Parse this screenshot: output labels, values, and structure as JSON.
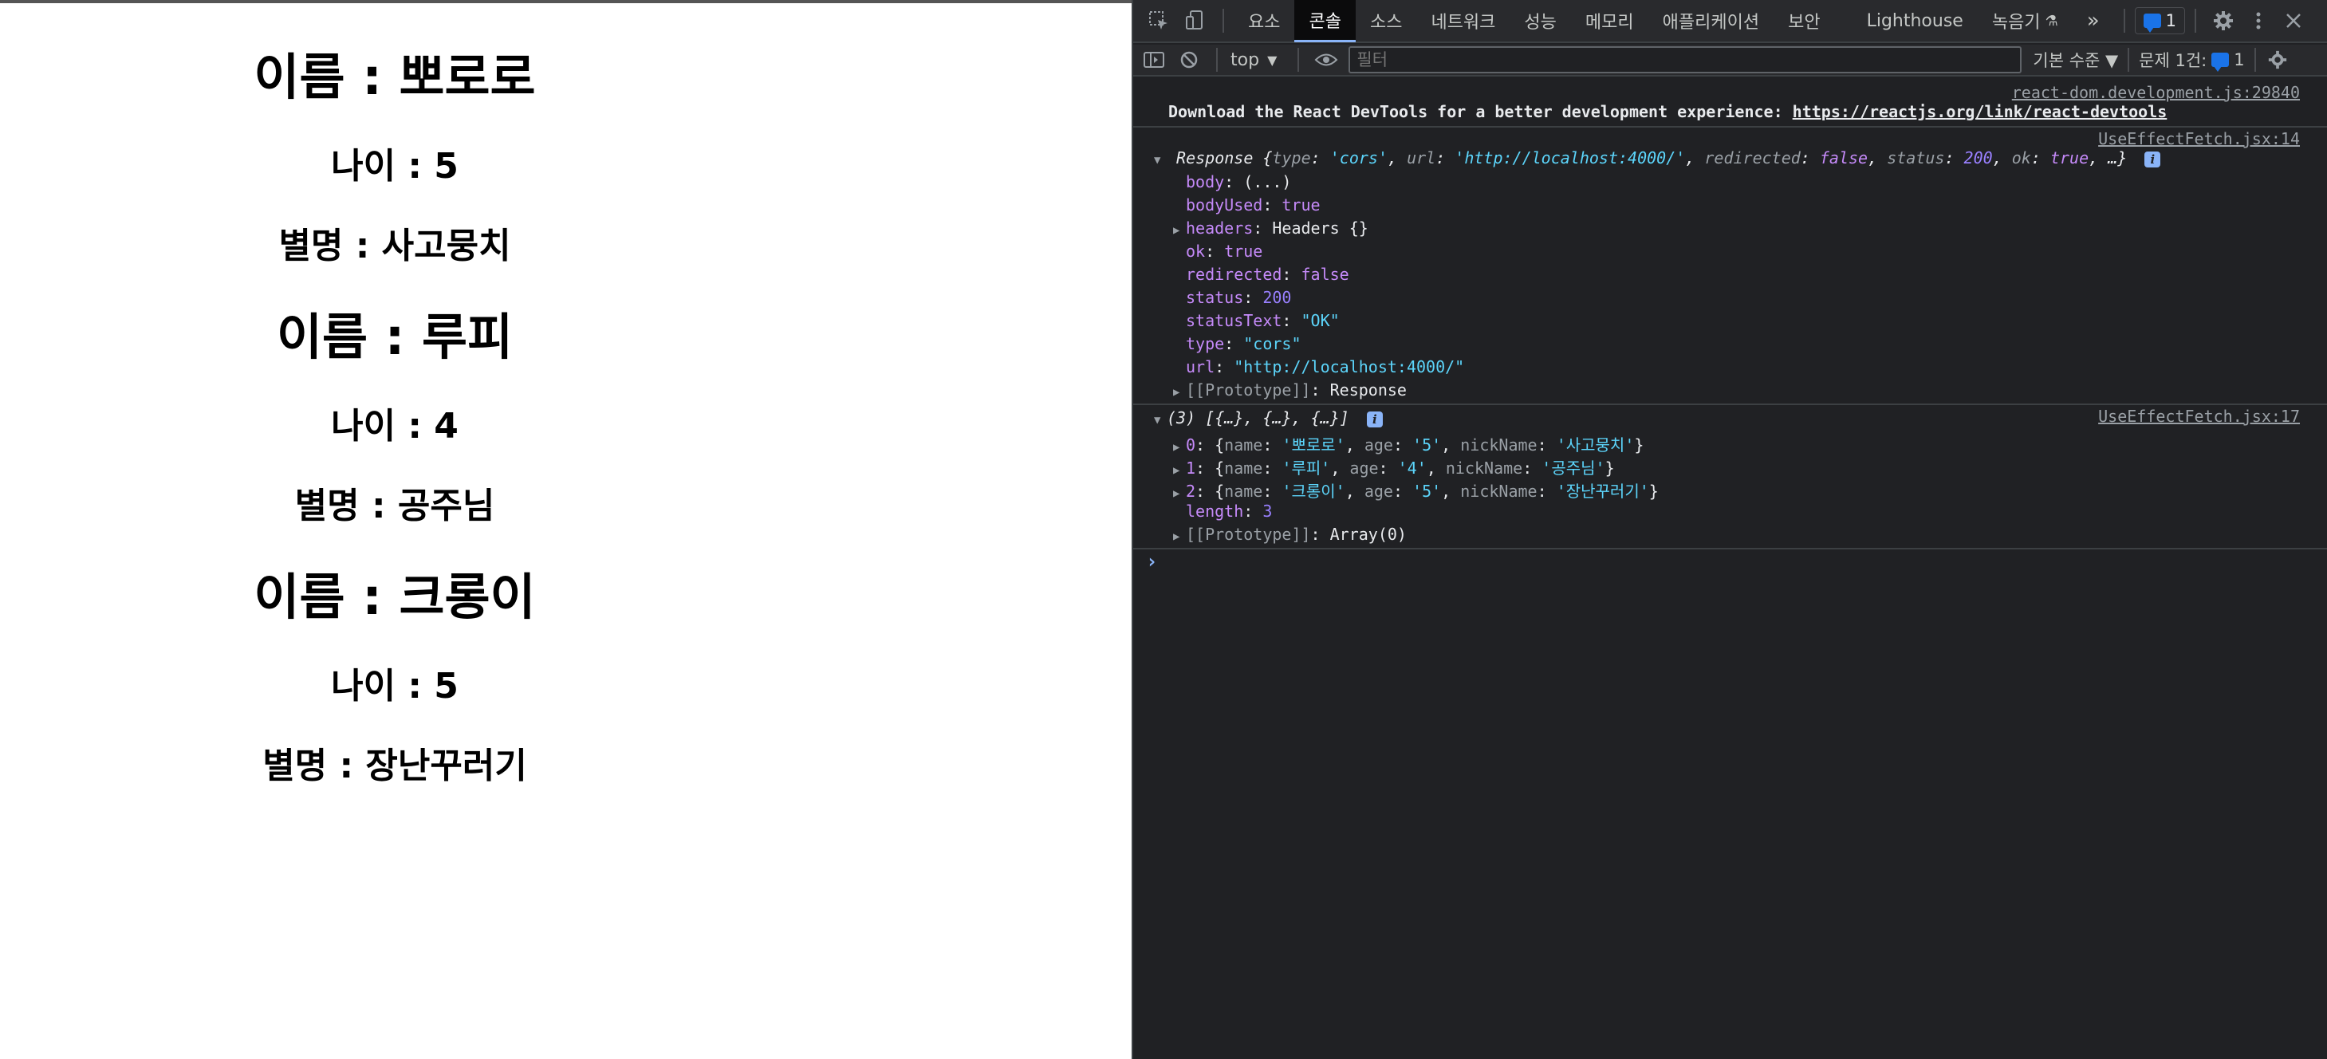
{
  "app": {
    "persons": [
      {
        "name_line": "이름 : 뽀로로",
        "age_line": "나이 : 5",
        "nick_line": "별명 : 사고뭉치"
      },
      {
        "name_line": "이름 : 루피",
        "age_line": "나이 : 4",
        "nick_line": "별명 : 공주님"
      },
      {
        "name_line": "이름 : 크롱이",
        "age_line": "나이 : 5",
        "nick_line": "별명 : 장난꾸러기"
      }
    ]
  },
  "devtools": {
    "tabs": [
      "요소",
      "콘솔",
      "소스",
      "네트워크",
      "성능",
      "메모리",
      "애플리케이션",
      "보안",
      "Lighthouse",
      "녹음기"
    ],
    "active_tab": "콘솔",
    "more_tabs_glyph": "»",
    "message_count": "1",
    "context": "top",
    "filter_placeholder": "필터",
    "level_label": "기본 수준 ▼",
    "issues_label": "문제 1건:",
    "issues_count": "1",
    "console": {
      "devtools_source": "react-dom.development.js:29840",
      "devtools_msg": "Download the React DevTools for a better development experience: ",
      "devtools_link": "https://reactjs.org/link/react-devtools",
      "response_source": "UseEffectFetch.jsx:14",
      "response_summary": {
        "label": "Response",
        "type": "'cors'",
        "url": "'http://localhost:4000/'",
        "redirected": "false",
        "status": "200",
        "ok": "true"
      },
      "response_props": [
        {
          "key": "body",
          "value": "(...)",
          "kind": "plain"
        },
        {
          "key": "bodyUsed",
          "value": "true",
          "kind": "bool"
        },
        {
          "key": "headers",
          "value": "Headers {}",
          "kind": "plain",
          "expandable": true
        },
        {
          "key": "ok",
          "value": "true",
          "kind": "bool"
        },
        {
          "key": "redirected",
          "value": "false",
          "kind": "bool"
        },
        {
          "key": "status",
          "value": "200",
          "kind": "num"
        },
        {
          "key": "statusText",
          "value": "\"OK\"",
          "kind": "str"
        },
        {
          "key": "type",
          "value": "\"cors\"",
          "kind": "str"
        },
        {
          "key": "url",
          "value": "\"http://localhost:4000/\"",
          "kind": "str"
        },
        {
          "key": "[[Prototype]]",
          "value": "Response",
          "kind": "plain",
          "expandable": true
        }
      ],
      "array_source": "UseEffectFetch.jsx:17",
      "array_summary": "(3) [{…}, {…}, {…}]",
      "array_items": [
        {
          "index": "0",
          "name": "'뽀로로'",
          "age": "'5'",
          "nickName": "'사고뭉치'"
        },
        {
          "index": "1",
          "name": "'루피'",
          "age": "'4'",
          "nickName": "'공주님'"
        },
        {
          "index": "2",
          "name": "'크롱이'",
          "age": "'5'",
          "nickName": "'장난꾸러기'"
        }
      ],
      "array_length": "3",
      "array_proto": "Array(0)"
    }
  },
  "colors": {
    "devtools_bg": "#202124",
    "string": "#5cd5fb",
    "number": "#9980ff",
    "keyword": "#c58af9",
    "accent": "#8ab4f8"
  }
}
